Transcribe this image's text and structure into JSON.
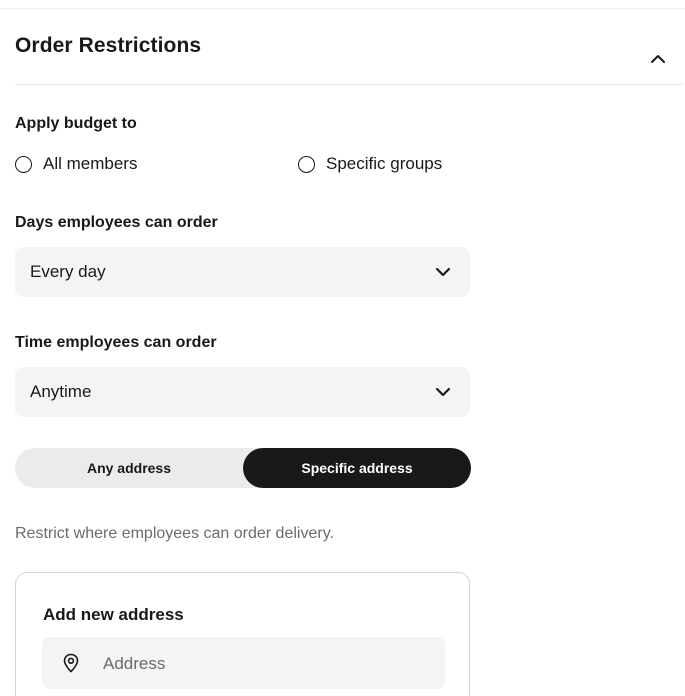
{
  "section": {
    "title": "Order Restrictions"
  },
  "apply_budget": {
    "label": "Apply budget to",
    "options": [
      "All members",
      "Specific groups"
    ]
  },
  "days": {
    "label": "Days employees can order",
    "value": "Every day"
  },
  "time": {
    "label": "Time employees can order",
    "value": "Anytime"
  },
  "address_mode": {
    "options": [
      "Any address",
      "Specific address"
    ],
    "selected": "Specific address"
  },
  "hint": "Restrict where employees can order delivery.",
  "add_address": {
    "title": "Add new address",
    "placeholder": "Address"
  },
  "colors": {
    "accent": "#191919",
    "field_bg": "#f4f4f4",
    "muted_text": "#6b6b6b"
  }
}
